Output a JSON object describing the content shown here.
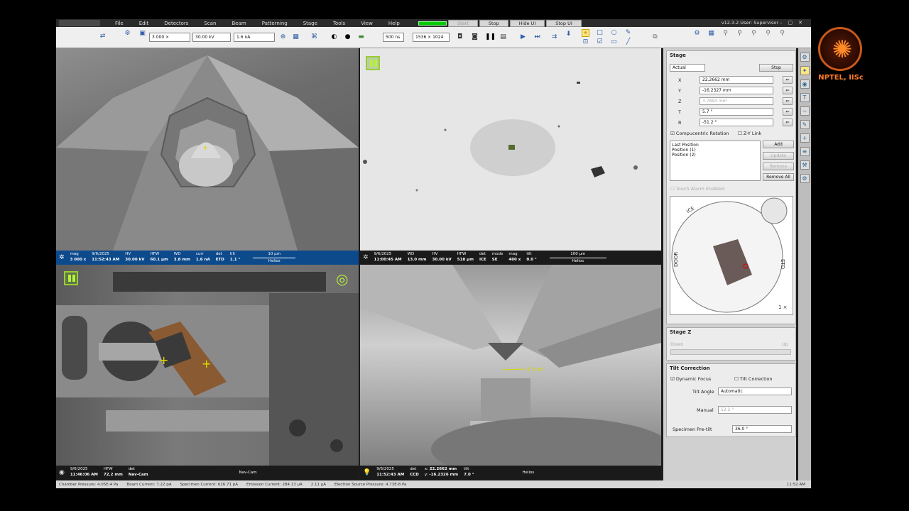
{
  "menu": [
    "File",
    "Edit",
    "Detectors",
    "Scan",
    "Beam",
    "Patterning",
    "Stage",
    "Tools",
    "View",
    "Help"
  ],
  "acq": {
    "stop": "Stop",
    "hide_ui": "Hide UI",
    "stop_ui": "Stop UI",
    "dim": "Start"
  },
  "user_info": "v12.3.2   User: Supervisor",
  "toolbar": {
    "mag": "3 000 ×",
    "hv": "30.00 kV",
    "current": "1.6 nA",
    "scan": "500 ns",
    "res": "1536 × 1024"
  },
  "quad1": {
    "databar": [
      {
        "label": "mag",
        "value": "3 000 x"
      },
      {
        "label": "9/6/2025",
        "value": "11:52:43 AM"
      },
      {
        "label": "HV",
        "value": "30.00 kV"
      },
      {
        "label": "HFW",
        "value": "60.1 µm"
      },
      {
        "label": "WD",
        "value": "3.8 mm"
      },
      {
        "label": "curr",
        "value": "1.6 nA"
      },
      {
        "label": "det",
        "value": "ETD"
      },
      {
        "label": "tilt",
        "value": "1.1 °"
      }
    ],
    "scalebar": "10 µm",
    "instrument": "Helios"
  },
  "quad2": {
    "databar": [
      {
        "label": "9/6/2025",
        "value": "11:00:45 AM"
      },
      {
        "label": "WD",
        "value": "13.0 mm"
      },
      {
        "label": "HV",
        "value": "30.00 kV"
      },
      {
        "label": "HFW",
        "value": "518 µm"
      },
      {
        "label": "det",
        "value": "ICE"
      },
      {
        "label": "mode",
        "value": "SE"
      },
      {
        "label": "mag",
        "value": "400 x"
      },
      {
        "label": "tilt",
        "value": "0.0 °"
      }
    ],
    "scalebar": "100 µm",
    "instrument": "Helios"
  },
  "quad3": {
    "databar": [
      {
        "label": "9/6/2025",
        "value": "11:46:06 AM"
      },
      {
        "label": "HFW",
        "value": "72.2 mm"
      },
      {
        "label": "det",
        "value": "Nav-Cam"
      }
    ],
    "caption": "Nav-Cam"
  },
  "quad4": {
    "databar": [
      {
        "label": "9/6/2025",
        "value": "11:52:43 AM"
      },
      {
        "label": "det",
        "value": "CCD"
      },
      {
        "label": "x:",
        "value": "22.2662 mm"
      },
      {
        "label": "y:",
        "value": "-16.2326 mm"
      },
      {
        "label": "tilt",
        "value": "7.0 °"
      }
    ],
    "caption": "Helios",
    "annotation": "4 mm"
  },
  "stage": {
    "title": "Stage",
    "mode": "Actual",
    "stop": "Stop",
    "x_label": "X",
    "x": "22.2662 mm",
    "y_label": "Y",
    "y": "-16.2327 mm",
    "z_label": "Z",
    "z": "3.7893 mm",
    "t_label": "T",
    "t": "5.7 °",
    "r_label": "R",
    "r": "-51.2 °",
    "compucentric": "Compucentric Rotation",
    "zy_link": "Z-Y Link",
    "positions": [
      "Last Position",
      "Position (1)",
      "Position (2)"
    ],
    "add": "Add",
    "update": "Update",
    "remove": "Remove",
    "remove_all": "Remove All",
    "touch_alarm": "Touch Alarm Enabled",
    "nav": {
      "door": "DOOR",
      "etd": "ETD",
      "ice": "ICE",
      "zoom": "1 ×"
    }
  },
  "stage_z": {
    "title": "Stage Z",
    "down": "Down",
    "up": "Up"
  },
  "tilt_corr": {
    "title": "Tilt Correction",
    "dynamic_focus": "Dynamic Focus",
    "tilt_correction": "Tilt Correction",
    "tilt_angle_label": "Tilt Angle",
    "tilt_angle": "Automatic",
    "manual_label": "Manual",
    "manual": "52.2 °",
    "pretilt_label": "Specimen Pre-tilt",
    "pretilt": "36.0 °"
  },
  "statusbar": {
    "chamber": "Chamber Pressure: 4.05E-4 Pa",
    "beam": "Beam Current: 7.22 pA",
    "specimen": "Specimen Current: 626.71 pA",
    "emission": "Emission Current: 284.13 µA",
    "e2": "2.11 µA",
    "source": "Electron Source Pressure: 4.73E-8 Pa",
    "time": "11:52 AM"
  },
  "brand": "NPTEL, IISc"
}
